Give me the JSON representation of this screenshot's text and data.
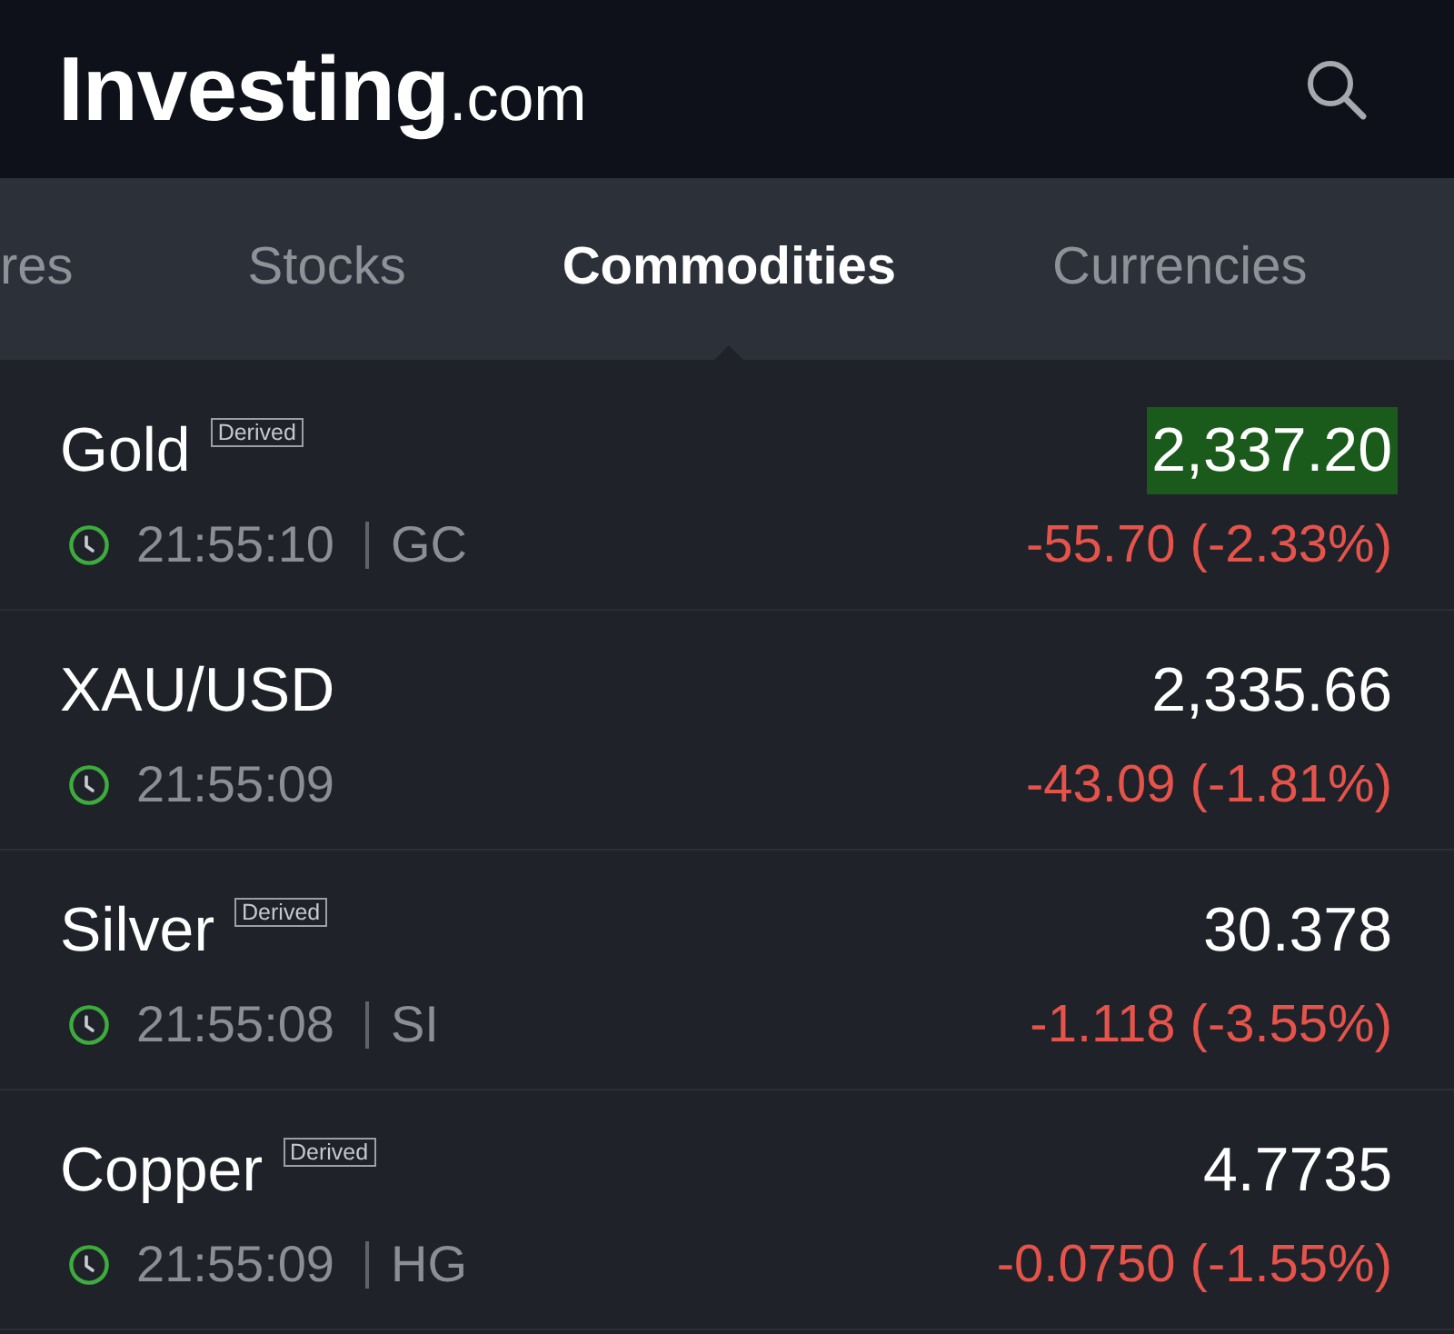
{
  "header": {
    "logo": {
      "name": "Investing",
      "domain": ".com"
    }
  },
  "tabs": [
    {
      "label": "res",
      "selected": false
    },
    {
      "label": "Stocks",
      "selected": false
    },
    {
      "label": "Commodities",
      "selected": true
    },
    {
      "label": "Currencies",
      "selected": false
    }
  ],
  "quotes": [
    {
      "name": "Gold",
      "tag": "Derived",
      "price": "2,337.20",
      "highlighted": true,
      "time": "21:55:10",
      "symbol": "GC",
      "change": "-55.70 (-2.33%)",
      "negative": true
    },
    {
      "name": "XAU/USD",
      "price": "2,335.66",
      "highlighted": false,
      "time": "21:55:09",
      "change": "-43.09 (-1.81%)",
      "negative": true
    },
    {
      "name": "Silver",
      "tag": "Derived",
      "price": "30.378",
      "highlighted": false,
      "time": "21:55:08",
      "symbol": "SI",
      "change": "-1.118 (-3.55%)",
      "negative": true
    },
    {
      "name": "Copper",
      "tag": "Derived",
      "price": "4.7735",
      "highlighted": false,
      "time": "21:55:09",
      "symbol": "HG",
      "change": "-0.0750 (-1.55%)",
      "negative": true
    }
  ]
}
